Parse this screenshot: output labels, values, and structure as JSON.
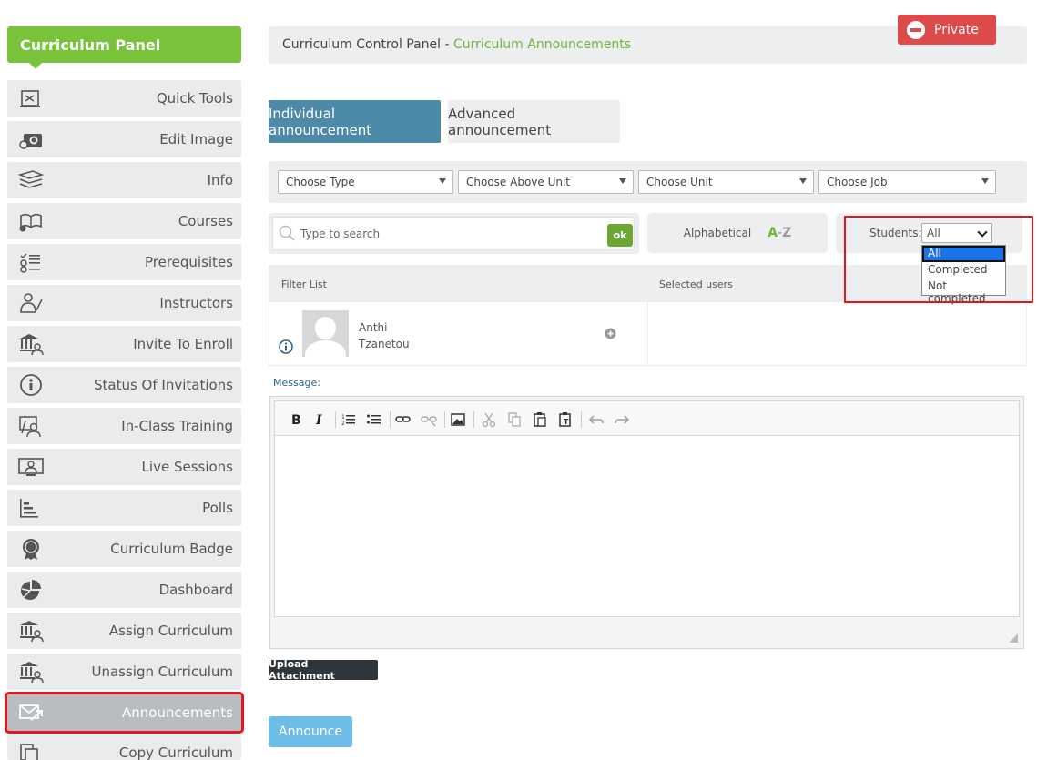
{
  "sidebar": {
    "title": "Curriculum Panel",
    "items": [
      {
        "label": "Quick Tools",
        "icon": "quick-tools-icon"
      },
      {
        "label": "Edit Image",
        "icon": "camera-gear-icon"
      },
      {
        "label": "Info",
        "icon": "books-icon"
      },
      {
        "label": "Courses",
        "icon": "open-book-gear-icon"
      },
      {
        "label": "Prerequisites",
        "icon": "checklist-icon"
      },
      {
        "label": "Instructors",
        "icon": "instructor-icon"
      },
      {
        "label": "Invite To Enroll",
        "icon": "institution-user-icon"
      },
      {
        "label": "Status Of Invitations",
        "icon": "info-circle-icon"
      },
      {
        "label": "In-Class Training",
        "icon": "classroom-icon"
      },
      {
        "label": "Live Sessions",
        "icon": "monitor-user-icon"
      },
      {
        "label": "Polls",
        "icon": "bar-chart-icon"
      },
      {
        "label": "Curriculum Badge",
        "icon": "badge-icon"
      },
      {
        "label": "Dashboard",
        "icon": "pie-chart-icon"
      },
      {
        "label": "Assign Curriculum",
        "icon": "institution-user-icon"
      },
      {
        "label": "Unassign Curriculum",
        "icon": "institution-user-icon"
      },
      {
        "label": "Announcements",
        "icon": "envelope-arrow-icon",
        "active": true
      },
      {
        "label": "Copy Curriculum",
        "icon": "copy-icon"
      }
    ]
  },
  "header": {
    "breadcrumb_root": "Curriculum Control Panel",
    "breadcrumb_sep": " - ",
    "breadcrumb_current": "Curriculum Announcements",
    "private_label": "Private"
  },
  "tabs": {
    "individual": "Individual announcement",
    "advanced": "Advanced announcement"
  },
  "filters": {
    "type": "Choose Type",
    "above_unit": "Choose Above Unit",
    "unit": "Choose Unit",
    "job": "Choose Job"
  },
  "search": {
    "placeholder": "Type to search",
    "ok_label": "ok"
  },
  "sort": {
    "label": "Alphabetical",
    "a": "A",
    "dash": "-",
    "z": "Z"
  },
  "students": {
    "label": "Students:",
    "selected": "All",
    "options": [
      "All",
      "Completed",
      "Not completed"
    ]
  },
  "list": {
    "filter_header": "Filter List",
    "selected_header": "Selected users",
    "users": [
      {
        "first": "Anthi",
        "last": "Tzanetou"
      }
    ]
  },
  "message": {
    "label": "Message:"
  },
  "buttons": {
    "upload": "Upload Attachment",
    "announce": "Announce"
  },
  "colors": {
    "accent_green": "#78c33a",
    "tab_active": "#4d8aa8",
    "private_red": "#dd4a4a",
    "highlight_red": "#e0181e",
    "announce_blue": "#6dbde9"
  }
}
